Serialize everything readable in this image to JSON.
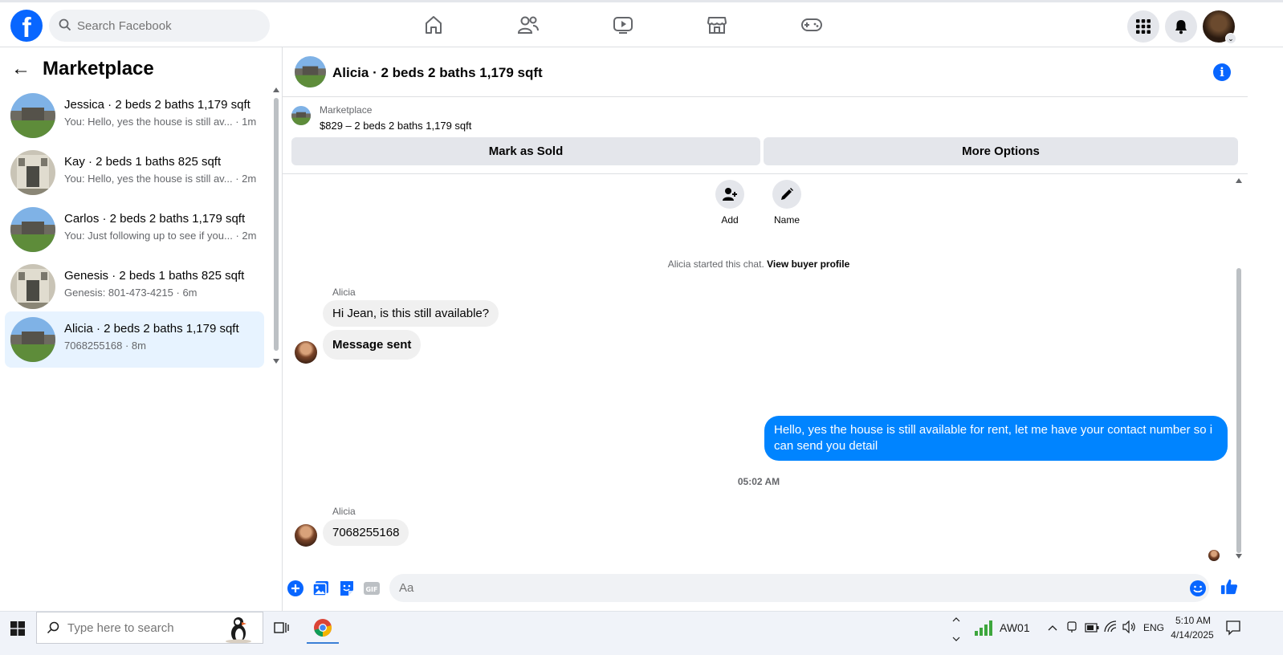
{
  "colors": {
    "brand": "#0866ff",
    "outgoing_bubble": "#0084ff",
    "active_conv": "#e7f3ff"
  },
  "header": {
    "logo": "f",
    "search_placeholder": "Search Facebook",
    "nav_icons": [
      "home-icon",
      "friends-icon",
      "video-icon",
      "marketplace-icon",
      "gaming-icon"
    ],
    "right_icons": [
      "menu-grid-icon",
      "notifications-bell-icon",
      "profile-avatar"
    ]
  },
  "sidebar": {
    "title": "Marketplace",
    "conversations": [
      {
        "name": "Jessica · 2 beds 2 baths 1,179 sqft",
        "preview": "You: Hello, yes the house is still av...",
        "time": "· 1m",
        "active": false
      },
      {
        "name": "Kay · 2 beds 1 baths 825 sqft",
        "preview": "You: Hello, yes the house is still av...",
        "time": "· 2m",
        "active": false
      },
      {
        "name": "Carlos · 2 beds 2 baths 1,179 sqft",
        "preview": "You: Just following up to see if you...",
        "time": "· 2m",
        "active": false
      },
      {
        "name": "Genesis · 2 beds 1 baths 825 sqft",
        "preview": "Genesis: 801-473-4215",
        "time": "· 6m",
        "active": false
      },
      {
        "name": "Alicia · 2 beds 2 baths 1,179 sqft",
        "preview": "7068255168",
        "time": "· 8m",
        "active": true
      }
    ]
  },
  "conversation": {
    "title": "Alicia · 2 beds 2 baths 1,179 sqft",
    "listing_kind": "Marketplace",
    "listing_price": "$829 – 2 beds 2 baths 1,179 sqft",
    "mark_sold": "Mark as Sold",
    "more_options": "More Options",
    "add_label": "Add",
    "name_label": "Name",
    "started_text": "Alicia started this chat.",
    "view_profile": "View buyer profile",
    "sender_name": "Alicia",
    "msg1": "Hi Jean, is this still available?",
    "msg2": "Message sent",
    "msg_out": "Hello, yes the house is still available for rent, let me have your contact number so i can send you detail",
    "timestamp": "05:02 AM",
    "sender_name2": "Alicia",
    "msg3": "7068255168",
    "composer_placeholder": "Aa"
  },
  "taskbar": {
    "search_placeholder": "Type here to search",
    "network": "AW01",
    "lang": "ENG",
    "time": "5:10 AM",
    "date": "4/14/2025"
  }
}
